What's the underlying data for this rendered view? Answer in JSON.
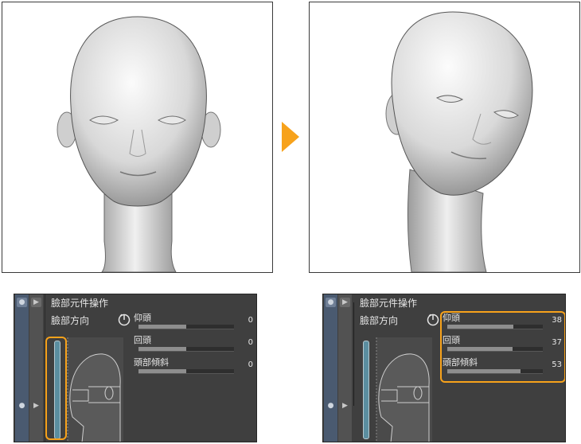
{
  "colors": {
    "accent_orange": "#F7A21B",
    "panel_bg": "#3F3F3F",
    "slider_fill": "#8E8E8E",
    "handle_blue": "#5B8EA0",
    "text": "#E6E6E6"
  },
  "icons": {
    "arrow": "orange-triangle-right-icon",
    "eye": "eye-icon",
    "play": "play-icon",
    "dial": "rotation-dial-icon"
  },
  "before": {
    "title": "臉部元件操作",
    "direction_label": "臉部方向",
    "sliders": [
      {
        "label": "仰頭",
        "value": "0",
        "level": 0.5
      },
      {
        "label": "回頭",
        "value": "0",
        "level": 0.5
      },
      {
        "label": "頭部傾斜",
        "value": "0",
        "level": 0.5
      }
    ]
  },
  "after": {
    "title": "臉部元件操作",
    "direction_label": "臉部方向",
    "sliders": [
      {
        "label": "仰頭",
        "value": "38",
        "level": 0.69
      },
      {
        "label": "回頭",
        "value": "37",
        "level": 0.68
      },
      {
        "label": "頭部傾斜",
        "value": "53",
        "level": 0.765
      }
    ]
  }
}
